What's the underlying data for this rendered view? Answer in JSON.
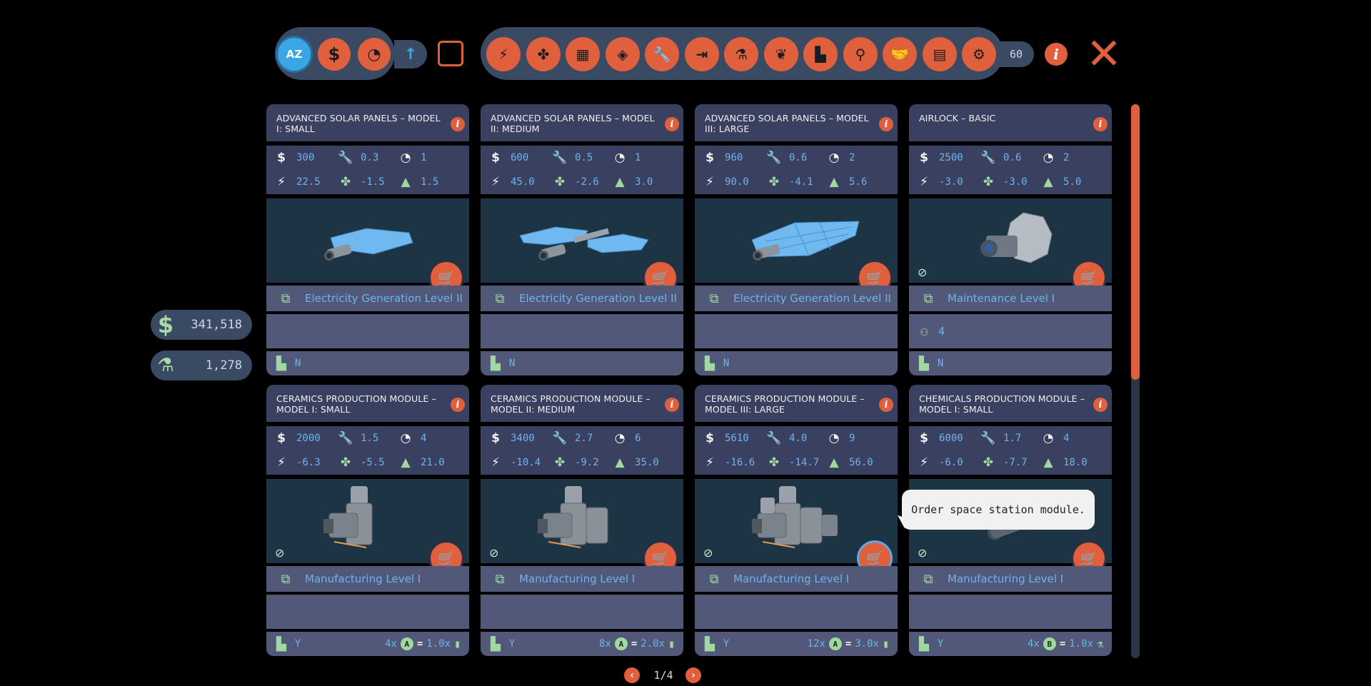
{
  "toolbar": {
    "sort_buttons": [
      {
        "name": "sort-alphabetical",
        "label": "AZ",
        "icon": "az-sort-icon",
        "active": true
      },
      {
        "name": "sort-price",
        "label": "$",
        "icon": "dollar-icon"
      },
      {
        "name": "sort-time",
        "label": "◔",
        "icon": "build-time-icon"
      }
    ],
    "order_arrow": "↑",
    "filter_buttons": [
      {
        "icon": "electricity-icon",
        "glyph": "⚡"
      },
      {
        "icon": "life-support-fan-icon",
        "glyph": "✤"
      },
      {
        "icon": "storage-icon",
        "glyph": "▦"
      },
      {
        "icon": "crew-quarters-icon",
        "glyph": "◈"
      },
      {
        "icon": "maintenance-icon",
        "glyph": "🔧"
      },
      {
        "icon": "docking-icon",
        "glyph": "⇥"
      },
      {
        "icon": "chemistry-icon",
        "glyph": "⚗"
      },
      {
        "icon": "food-icon",
        "glyph": "❦"
      },
      {
        "icon": "manufacturing-icon",
        "glyph": "▙"
      },
      {
        "icon": "research-icon",
        "glyph": "⚲"
      },
      {
        "icon": "trade-handshake-icon",
        "glyph": "🤝"
      },
      {
        "icon": "document-icon",
        "glyph": "▤"
      },
      {
        "icon": "refinery-icon",
        "glyph": "⚙"
      }
    ],
    "count": "60",
    "info_label": "i",
    "close_label": "✕"
  },
  "resources": {
    "money": {
      "icon": "dollar-icon",
      "glyph": "$",
      "value": "341,518"
    },
    "research": {
      "icon": "microscope-icon",
      "glyph": "⚗",
      "value": "1,278"
    }
  },
  "cards": [
    {
      "title": "ADVANCED SOLAR PANELS – MODEL I: SMALL",
      "cost": "300",
      "maintenance": "0.3",
      "time": "1",
      "power": "22.5",
      "air": "-1.5",
      "mass": "1.5",
      "image_icon": "solar-panel-small-model",
      "gauge": false,
      "requirement": "Electricity Generation Level II",
      "mid": "",
      "factory": "N",
      "recipe": null
    },
    {
      "title": "ADVANCED SOLAR PANELS – MODEL II: MEDIUM",
      "cost": "600",
      "maintenance": "0.5",
      "time": "1",
      "power": "45.0",
      "air": "-2.6",
      "mass": "3.0",
      "image_icon": "solar-panel-medium-model",
      "gauge": false,
      "requirement": "Electricity Generation Level II",
      "mid": "",
      "factory": "N",
      "recipe": null
    },
    {
      "title": "ADVANCED SOLAR PANELS – MODEL III: LARGE",
      "cost": "960",
      "maintenance": "0.6",
      "time": "2",
      "power": "90.0",
      "air": "-4.1",
      "mass": "5.6",
      "image_icon": "solar-panel-large-model",
      "gauge": false,
      "requirement": "Electricity Generation Level II",
      "mid": "",
      "factory": "N",
      "recipe": null
    },
    {
      "title": "AIRLOCK – BASIC",
      "cost": "2500",
      "maintenance": "0.6",
      "time": "2",
      "power": "-3.0",
      "air": "-3.0",
      "mass": "5.0",
      "image_icon": "airlock-model",
      "gauge": true,
      "requirement": "Maintenance Level I",
      "mid": "4",
      "factory": "N",
      "recipe": null
    },
    {
      "title": "CERAMICS PRODUCTION MODULE – MODEL I: SMALL",
      "cost": "2000",
      "maintenance": "1.5",
      "time": "4",
      "power": "-6.3",
      "air": "-5.5",
      "mass": "21.0",
      "image_icon": "ceramics-module-small-model",
      "gauge": true,
      "requirement": "Manufacturing Level I",
      "mid": "",
      "factory": "Y",
      "recipe": {
        "in_qty": "4x",
        "in_badge": "A",
        "out_qty": "1.0x",
        "out_icon": "bottle-icon",
        "out_glyph": "▮"
      }
    },
    {
      "title": "CERAMICS PRODUCTION MODULE – MODEL II: MEDIUM",
      "cost": "3400",
      "maintenance": "2.7",
      "time": "6",
      "power": "-10.4",
      "air": "-9.2",
      "mass": "35.0",
      "image_icon": "ceramics-module-medium-model",
      "gauge": true,
      "requirement": "Manufacturing Level I",
      "mid": "",
      "factory": "Y",
      "recipe": {
        "in_qty": "8x",
        "in_badge": "A",
        "out_qty": "2.0x",
        "out_icon": "bottle-icon",
        "out_glyph": "▮"
      }
    },
    {
      "title": "CERAMICS PRODUCTION MODULE – MODEL III: LARGE",
      "cost": "5610",
      "maintenance": "4.0",
      "time": "9",
      "power": "-16.6",
      "air": "-14.7",
      "mass": "56.0",
      "image_icon": "ceramics-module-large-model",
      "gauge": true,
      "requirement": "Manufacturing Level I",
      "mid": "",
      "factory": "Y",
      "recipe": {
        "in_qty": "12x",
        "in_badge": "A",
        "out_qty": "3.0x",
        "out_icon": "bottle-icon",
        "out_glyph": "▮"
      },
      "cart_hover": true
    },
    {
      "title": "CHEMICALS PRODUCTION MODULE – MODEL I: SMALL",
      "cost": "6000",
      "maintenance": "1.7",
      "time": "4",
      "power": "-6.0",
      "air": "-7.7",
      "mass": "18.0",
      "image_icon": "chemicals-module-small-model",
      "gauge": true,
      "requirement": "Manufacturing Level I",
      "mid": "",
      "factory": "Y",
      "recipe": {
        "in_qty": "4x",
        "in_badge": "B",
        "out_qty": "1.0x",
        "out_icon": "flask-icon",
        "out_glyph": "⚗"
      }
    }
  ],
  "tooltip": {
    "text": "Order space station module."
  },
  "pagination": {
    "prev": "‹",
    "label": "1/4",
    "next": "›"
  },
  "colors": {
    "accent": "#e0603e",
    "value_blue": "#6fb3ee",
    "panel": "#3a4060",
    "panel_light": "#515878",
    "image_bg": "#1d3444",
    "sort_active": "#3aa6e6"
  }
}
